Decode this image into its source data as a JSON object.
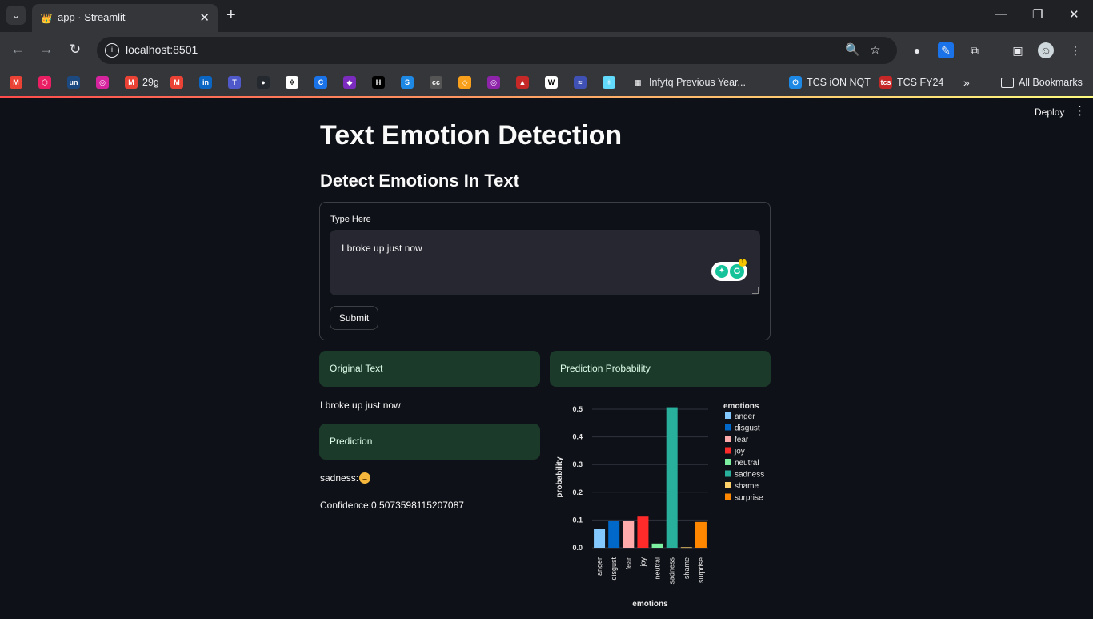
{
  "browser": {
    "tab_title": "app · Streamlit",
    "url": "localhost:8501",
    "bookmarks": [
      {
        "label": "",
        "icon": "gmail-icon",
        "color": "#ea4335"
      },
      {
        "label": "",
        "icon": "hexagon-icon",
        "color": "#e91e63"
      },
      {
        "label": "",
        "icon": "unstop-icon",
        "color": "#1c4980"
      },
      {
        "label": "",
        "icon": "instagram-icon",
        "color": "#d6249f"
      },
      {
        "label": "29g",
        "icon": "gmail-icon",
        "color": "#ea4335"
      },
      {
        "label": "",
        "icon": "gmail-icon",
        "color": "#ea4335"
      },
      {
        "label": "",
        "icon": "linkedin-icon",
        "color": "#0a66c2"
      },
      {
        "label": "",
        "icon": "teams-icon",
        "color": "#5059c9"
      },
      {
        "label": "",
        "icon": "github-icon",
        "color": "#24292f"
      },
      {
        "label": "",
        "icon": "bookmark-icon",
        "color": "#ffffff"
      },
      {
        "label": "",
        "icon": "c-icon",
        "color": "#1a73e8"
      },
      {
        "label": "",
        "icon": "shield-icon",
        "color": "#7b2cbf"
      },
      {
        "label": "",
        "icon": "hackerrank-icon",
        "color": "#000000"
      },
      {
        "label": "",
        "icon": "s-icon",
        "color": "#1e88e5"
      },
      {
        "label": "",
        "icon": "cc-icon",
        "color": "#555555"
      },
      {
        "label": "",
        "icon": "leetcode-icon",
        "color": "#f89f1b"
      },
      {
        "label": "",
        "icon": "circle-icon",
        "color": "#8e24aa"
      },
      {
        "label": "",
        "icon": "bank-icon",
        "color": "#c62828"
      },
      {
        "label": "",
        "icon": "w-icon",
        "color": "#ffffff"
      },
      {
        "label": "",
        "icon": "wave-icon",
        "color": "#3f51b5"
      },
      {
        "label": "",
        "icon": "react-icon",
        "color": "#61dafb"
      },
      {
        "label": "Infytq Previous Year...",
        "icon": "page-icon",
        "color": "#e8eaed"
      },
      {
        "label": "TCS iON NQT",
        "icon": "power-icon",
        "color": "#1e88e5"
      },
      {
        "label": "TCS FY24",
        "icon": "tcs-icon",
        "color": "#c62828"
      }
    ],
    "all_bookmarks": "All Bookmarks"
  },
  "app": {
    "deploy_label": "Deploy",
    "title": "Text Emotion Detection",
    "subheader": "Detect Emotions In Text",
    "form": {
      "label": "Type Here",
      "value": "I broke up just now",
      "submit_label": "Submit"
    },
    "original_text_header": "Original Text",
    "original_text": "I broke up just now",
    "prediction_header": "Prediction",
    "prediction": "sadness:",
    "confidence": "Confidence:0.5073598115207087",
    "probability_header": "Prediction Probability"
  },
  "chart_data": {
    "type": "bar",
    "categories": [
      "anger",
      "disgust",
      "fear",
      "joy",
      "neutral",
      "sadness",
      "shame",
      "surprise"
    ],
    "values": [
      0.068,
      0.098,
      0.098,
      0.115,
      0.015,
      0.507,
      0.002,
      0.093
    ],
    "colors": [
      "#83c9ff",
      "#0068c9",
      "#ffabab",
      "#ff2b2b",
      "#7defa1",
      "#29b09d",
      "#ffd16a",
      "#ff8700"
    ],
    "xlabel": "emotions",
    "ylabel": "probability",
    "legend_title": "emotions",
    "legend_position": "right",
    "yticks": [
      "0.0",
      "0.1",
      "0.2",
      "0.3",
      "0.4",
      "0.5"
    ],
    "ylim": [
      0,
      0.5
    ],
    "grid": true
  }
}
